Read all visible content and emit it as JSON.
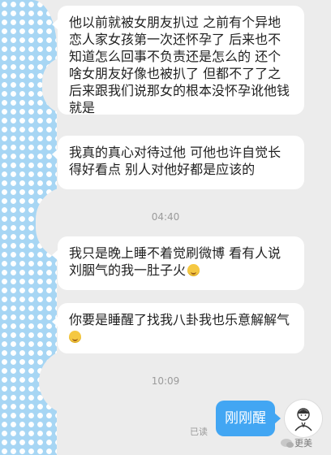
{
  "messages": [
    {
      "text": "他以前就被女朋友扒过 之前有个异地恋人家女孩第一次还怀孕了 后来也不知道怎么回事不负责还是怎么的 还个啥女朋友好像也被扒了 但都不了了之后来跟我们说那女的根本没怀孕讹他钱就是"
    },
    {
      "text": "我真的真心对待过他 可他也许自觉长得好看点 别人对他好都是应该的"
    },
    {
      "text": "我只是晚上睡不着觉刷微博 看有人说刘胭气的我一肚子火",
      "emoji": "smirk-emoji"
    },
    {
      "text": "你要是睡醒了找我八卦我也乐意解解气",
      "emoji": "laughing-emoji"
    }
  ],
  "timestamps": [
    "04:40",
    "10:09"
  ],
  "sent_message": {
    "text": "刚刚醒",
    "status": "已读"
  },
  "watermark": {
    "text": "更美"
  },
  "colors": {
    "background": "#ececec",
    "bubble": "#ffffff",
    "sent_bubble": "#42a6f3",
    "polka": "#a7d6f4"
  }
}
